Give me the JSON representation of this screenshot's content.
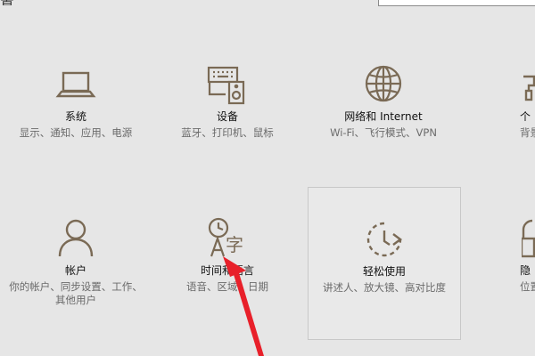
{
  "header": {
    "title_fragment": "置"
  },
  "search": {
    "placeholder": ""
  },
  "tiles": {
    "system": {
      "title": "系统",
      "desc": "显示、通知、应用、电源",
      "icon": "laptop-icon"
    },
    "devices": {
      "title": "设备",
      "desc": "蓝牙、打印机、鼠标",
      "icon": "keyboard-speaker-icon"
    },
    "network": {
      "title": "网络和 Internet",
      "desc": "Wi-Fi、飞行模式、VPN",
      "icon": "globe-icon"
    },
    "personal": {
      "title": "个",
      "desc": "背景、锁",
      "icon": "paint-icon"
    },
    "accounts": {
      "title": "帐户",
      "desc": "你的帐户、同步设置、工作、其他用户",
      "icon": "person-icon"
    },
    "time": {
      "title": "时间和语言",
      "desc": "语音、区域、日期",
      "icon": "clock-language-icon"
    },
    "ease": {
      "title": "轻松使用",
      "desc": "讲述人、放大镜、高对比度",
      "icon": "ease-of-access-icon"
    },
    "privacy": {
      "title": "隐",
      "desc": "位置、",
      "icon": "lock-icon"
    }
  },
  "colors": {
    "background": "#e6e6e6",
    "icon_stroke": "#7a6a55",
    "annotation": "#e8202a"
  }
}
